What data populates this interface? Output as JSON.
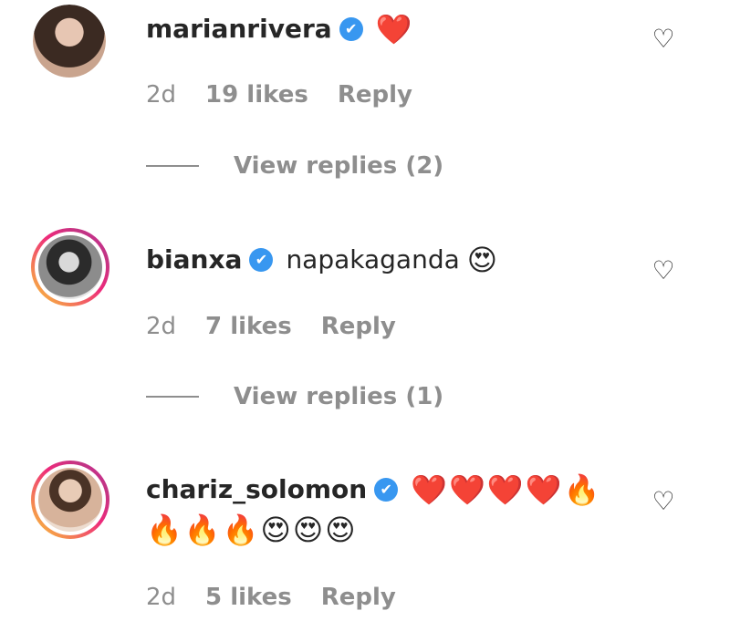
{
  "comments": [
    {
      "username": "marianrivera",
      "verified_icon": "✔",
      "text": "",
      "emojis": "❤️",
      "emojis_line2": "",
      "time": "2d",
      "likes": "19 likes",
      "reply_label": "Reply",
      "view_replies": "View replies (2)"
    },
    {
      "username": "bianxa",
      "verified_icon": "✔",
      "text": "napakaganda",
      "emojis": "😍",
      "emojis_line2": "",
      "time": "2d",
      "likes": "7 likes",
      "reply_label": "Reply",
      "view_replies": "View replies (1)"
    },
    {
      "username": "chariz_solomon",
      "verified_icon": "✔",
      "text": "",
      "emojis": "❤️❤️❤️❤️🔥",
      "emojis_line2": "🔥🔥🔥😍😍😍",
      "time": "2d",
      "likes": "5 likes",
      "reply_label": "Reply",
      "view_replies": ""
    }
  ],
  "like_icon": "♡",
  "colors": {
    "username": "#262626",
    "meta": "#8e8e8e",
    "verified": "#3897f0",
    "story_ring_start": "#f9ce34",
    "story_ring_end": "#ee2a7b"
  }
}
